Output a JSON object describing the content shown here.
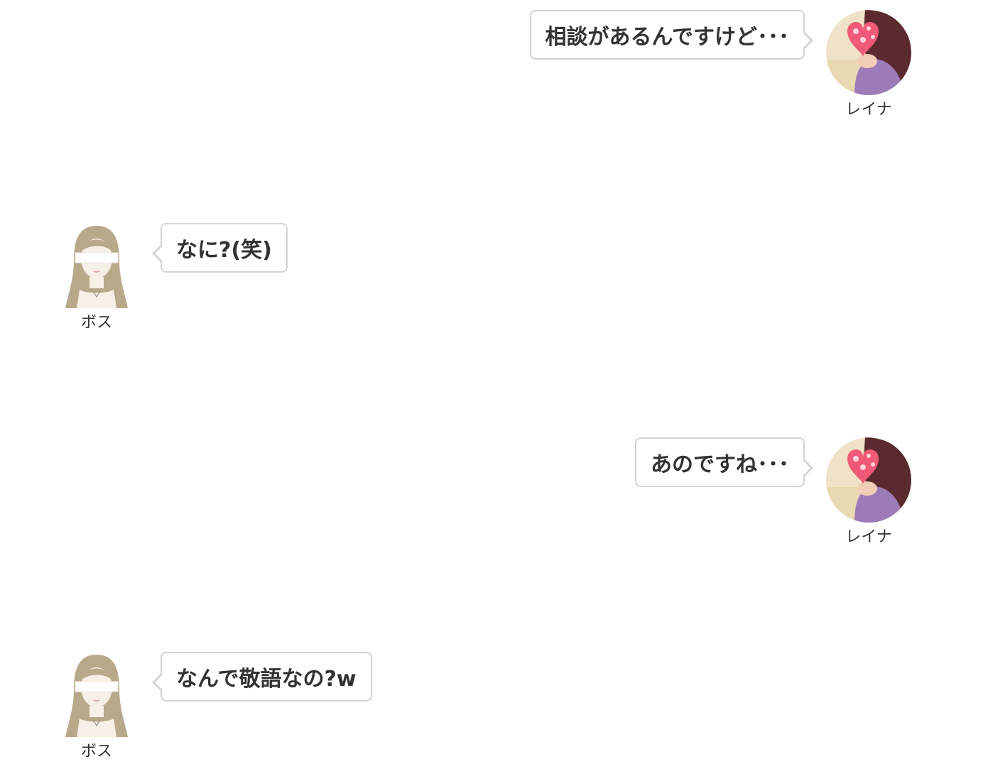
{
  "messages": [
    {
      "side": "right",
      "speaker": "レイナ",
      "text": "相談があるんですけど･･･"
    },
    {
      "side": "left",
      "speaker": "ボス",
      "text": "なに?(笑)"
    },
    {
      "side": "right",
      "speaker": "レイナ",
      "text": "あのですね･･･"
    },
    {
      "side": "left",
      "speaker": "ボス",
      "text": "なんで敬語なの?w"
    }
  ],
  "colors": {
    "bubble_border": "#d3d3d3",
    "text": "#333333",
    "heart_sticker": "#f05a78",
    "avatar_hair_boss": "#b9a98b"
  },
  "icons": {
    "reina_avatar": "profile-photo-with-heart-sticker",
    "boss_avatar": "illustrated-woman-long-hair"
  }
}
